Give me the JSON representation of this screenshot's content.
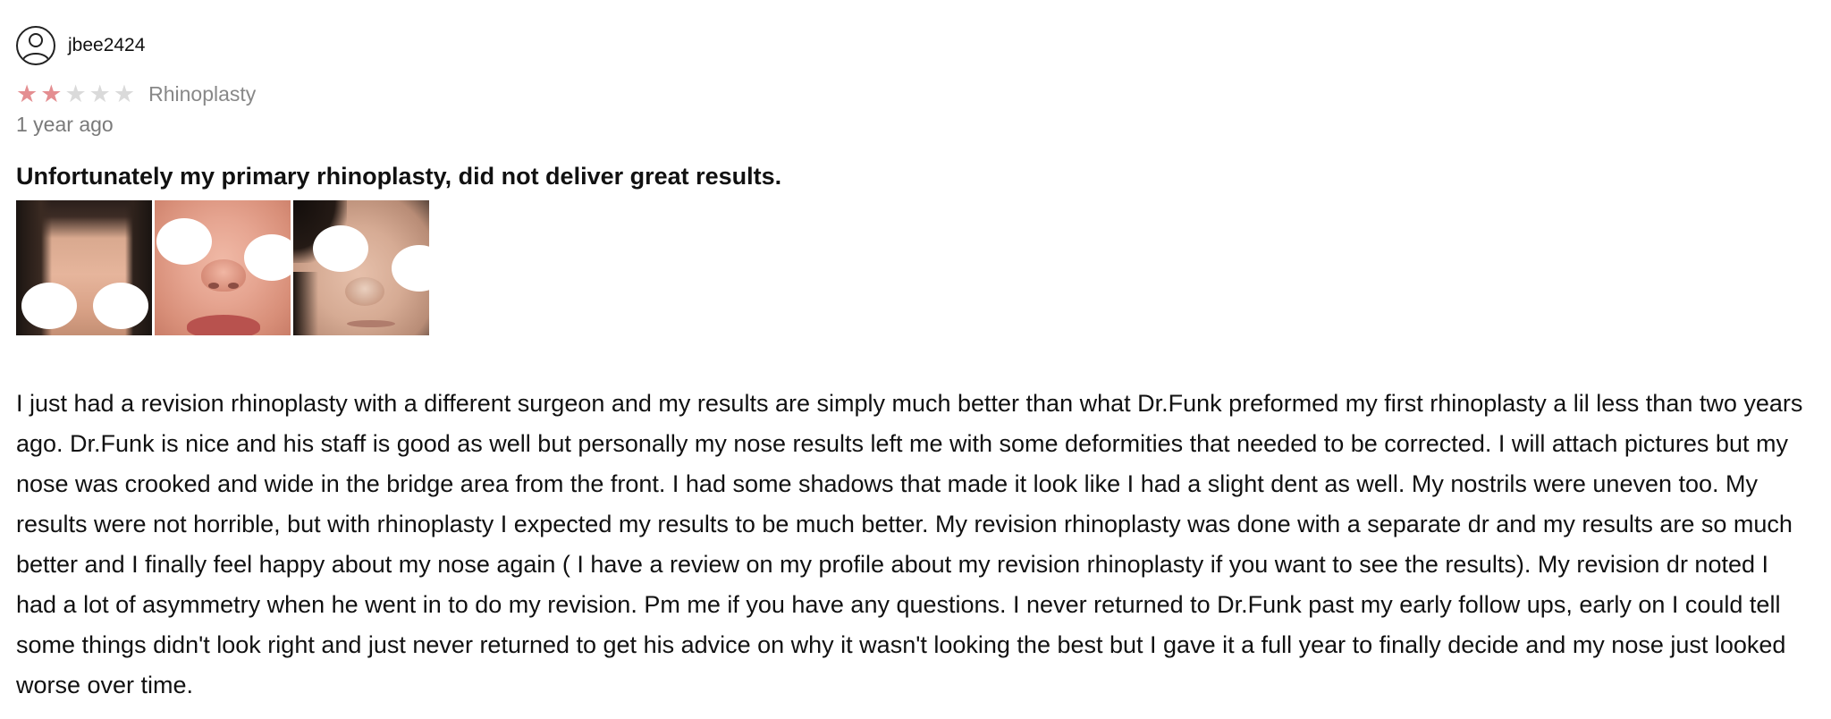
{
  "review": {
    "username": "jbee2424",
    "rating": 2,
    "rating_max": 5,
    "procedure": "Rhinoplasty",
    "time_ago": "1 year ago",
    "title": "Unfortunately my primary rhinoplasty, did not deliver great results.",
    "photos": [
      "review-photo-1",
      "review-photo-2",
      "review-photo-3"
    ],
    "body": "I just had a revision rhinoplasty with a different surgeon and my results are simply much better than what Dr.Funk preformed my first rhinoplasty a lil less than two years ago. Dr.Funk is nice and his staff is good as well but personally my nose results left me with some deformities that needed to be corrected. I will attach pictures but my nose was crooked and wide in the bridge area from the front. I had some shadows that made it look like I had a slight dent as well. My nostrils were uneven too. My results were not horrible, but with rhinoplasty I expected my results to be much better. My revision rhinoplasty was done with a separate dr and my results are so much better and I finally feel happy about my nose again ( I have a review on my profile about my revision rhinoplasty if you want to see the results). My revision dr noted I had a lot of asymmetry when he went in to do my revision. Pm me if you have any questions. I never returned to Dr.Funk past my early follow ups, early on I could tell some things didn't look right and just never returned to get his advice on why it wasn't looking the best but I gave it a full year to finally decide and my nose just looked worse over time."
  },
  "colors": {
    "star_filled": "#e48e91",
    "star_empty": "#dadada",
    "muted_text": "#888888"
  },
  "icons": {
    "avatar": "user-avatar-icon",
    "star": "star-icon"
  }
}
